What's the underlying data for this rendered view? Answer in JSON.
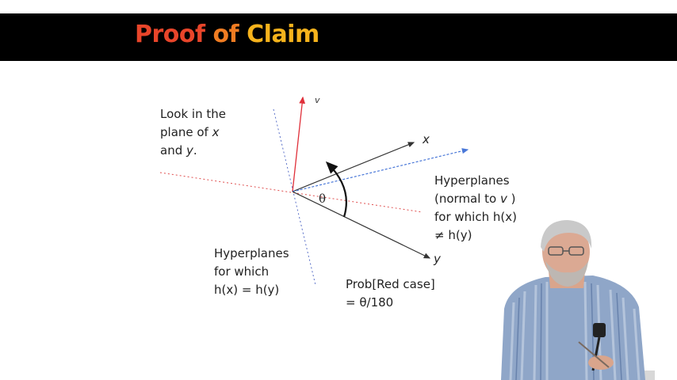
{
  "slide": {
    "title_words": [
      "Proof",
      "of",
      "Claim"
    ],
    "look_text": {
      "line1": "Look in the",
      "line2_pre": "plane of ",
      "line2_var": "x",
      "line3_pre": "and ",
      "line3_var": "y",
      "line3_post": "."
    },
    "labels": {
      "v": "v",
      "x": "x",
      "y": "y",
      "theta": "θ"
    },
    "hyperplanes_right": {
      "line1": "Hyperplanes",
      "line2_pre": "(normal to ",
      "line2_var": "v",
      "line2_post": " )",
      "line3": "for which h(x)",
      "line4": "≠ h(y)"
    },
    "hyperplanes_left": {
      "line1": "Hyperplanes",
      "line2": "for which",
      "line3": "h(x) = h(y)"
    },
    "prob": {
      "line1": "Prob[Red case]",
      "line2": "= θ/180"
    }
  },
  "colors": {
    "title_proof": "#e8452a",
    "title_of": "#f07c22",
    "title_claim": "#f6b31c",
    "v_vector": "#e0303a",
    "blue_vector": "#4a78d8",
    "red_dotted": "#e05050",
    "blue_dotted": "#5a70c8"
  }
}
